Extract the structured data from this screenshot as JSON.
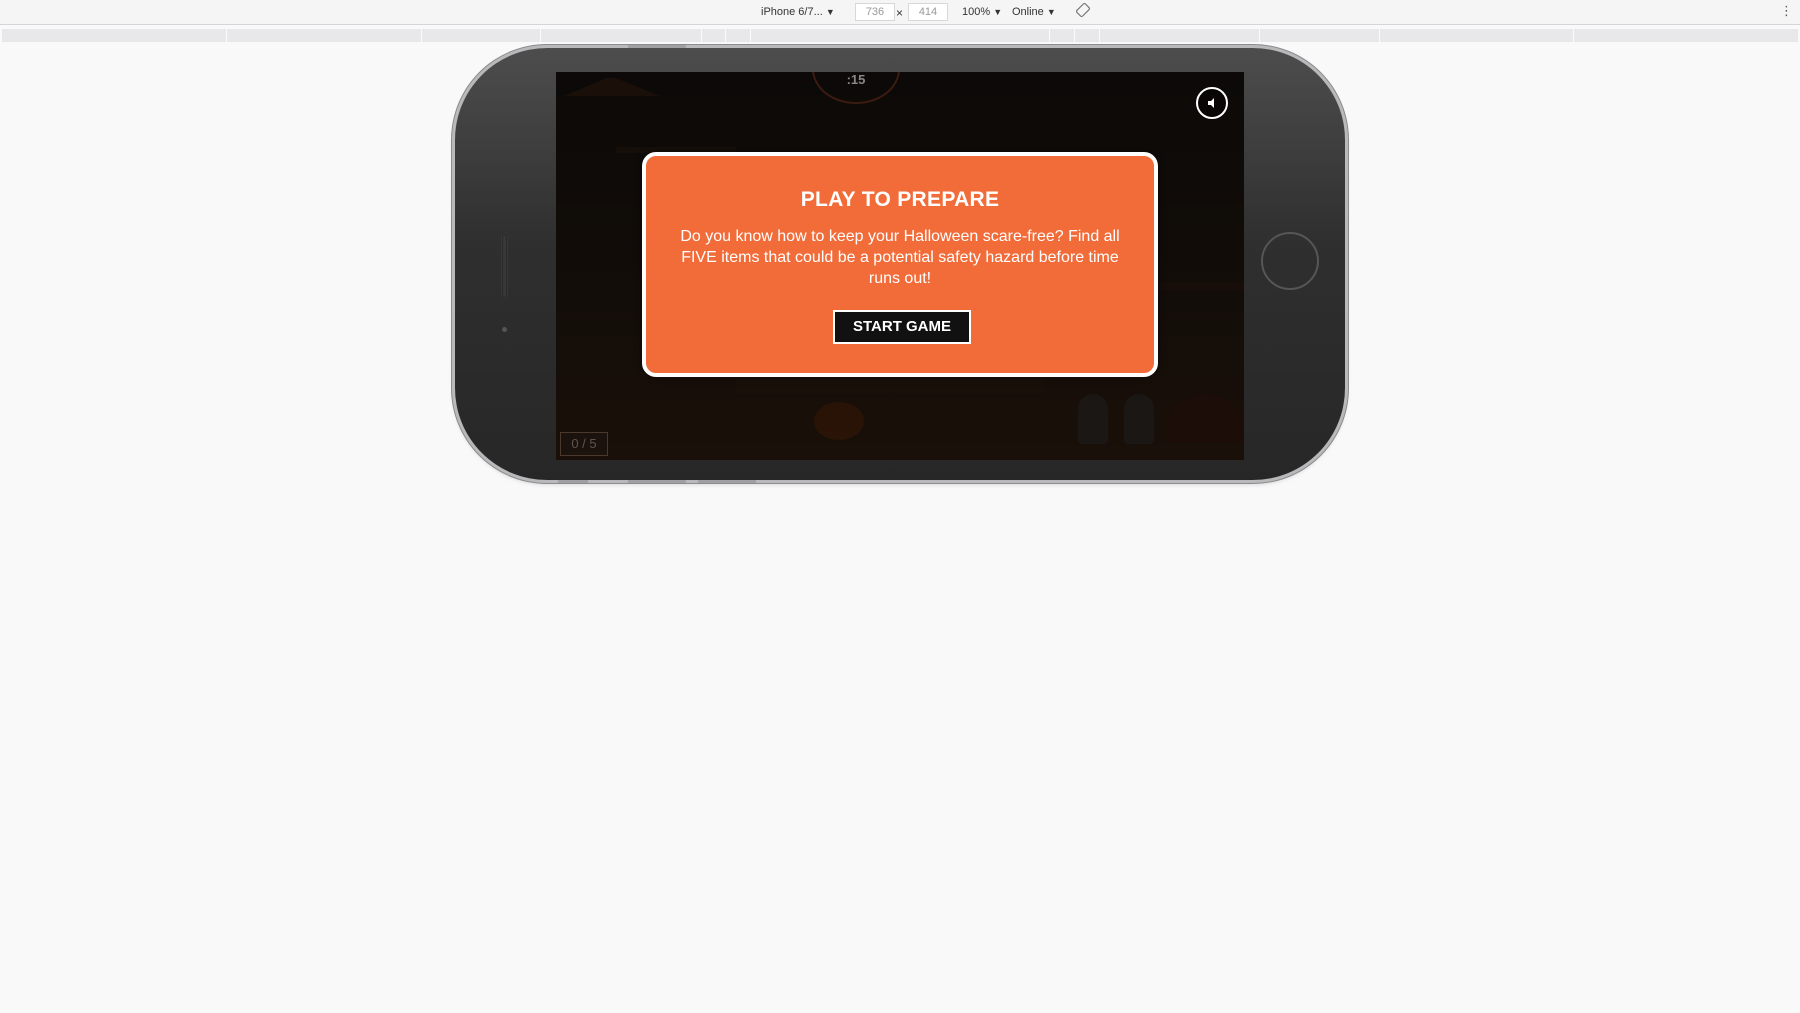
{
  "toolbar": {
    "device": "iPhone 6/7...",
    "width": "736",
    "height": "414",
    "separator": "×",
    "zoom": "100%",
    "throttle": "Online",
    "caret": "▼",
    "rotate_icon": "rotate-icon",
    "more_icon": "more-vert-icon",
    "more_glyph": "⋮"
  },
  "game": {
    "timer": ":15",
    "counter": "0 / 5",
    "sound_icon": "speaker-icon",
    "modal": {
      "title": "PLAY TO PREPARE",
      "text": "Do you know how to keep your Halloween scare-free? Find all FIVE items that could be a potential safety hazard before time runs out!",
      "button": "START GAME"
    }
  },
  "colors": {
    "modal_bg": "#f26c3a",
    "button_bg": "#111111",
    "toolbar_bg": "#f5f5f6",
    "page_bg": "#f9f9fa"
  }
}
